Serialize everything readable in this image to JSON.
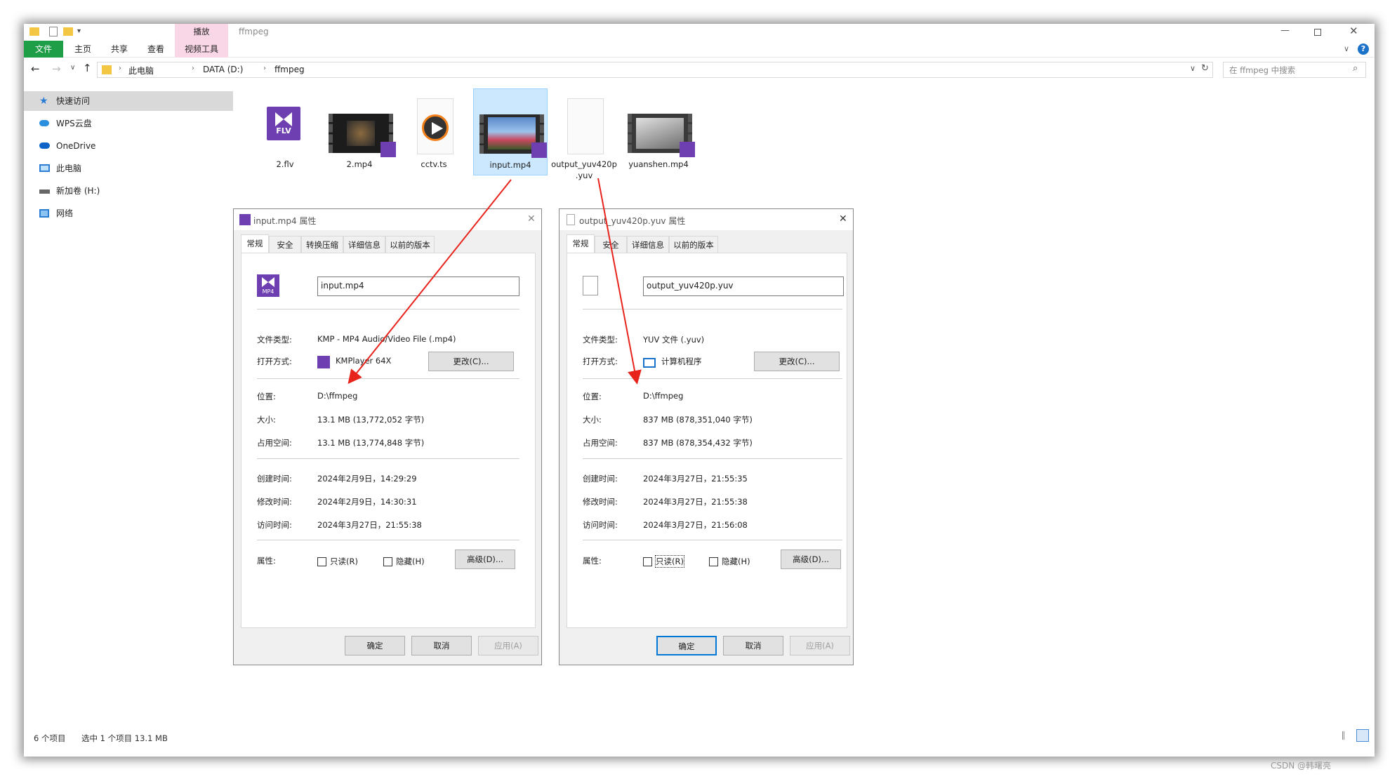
{
  "window": {
    "title": "ffmpeg",
    "context_tab": "播放",
    "ribbon_tabs": [
      "文件",
      "主页",
      "共享",
      "查看",
      "视频工具"
    ],
    "breadcrumb": [
      "此电脑",
      "DATA (D:)",
      "ffmpeg"
    ],
    "search_placeholder": "在 ffmpeg 中搜索",
    "help": "?"
  },
  "nav": {
    "items": [
      "快速访问",
      "WPS云盘",
      "OneDrive",
      "此电脑",
      "新加卷 (H:)",
      "网络"
    ]
  },
  "files": [
    {
      "name": "2.flv",
      "icon_text": "FLV"
    },
    {
      "name": "2.mp4"
    },
    {
      "name": "cctv.ts"
    },
    {
      "name": "input.mp4"
    },
    {
      "name": "output_yuv420p\n.yuv",
      "line1": "output_yuv420p",
      "line2": ".yuv"
    },
    {
      "name": "yuanshen.mp4"
    }
  ],
  "dialog1": {
    "title": "input.mp4 属性",
    "tabs": [
      "常规",
      "安全",
      "转换压缩",
      "详细信息",
      "以前的版本"
    ],
    "icon_text": "MP4",
    "filename": "input.mp4",
    "labels": {
      "type": "文件类型:",
      "open": "打开方式:",
      "loc": "位置:",
      "size": "大小:",
      "disk": "占用空间:",
      "created": "创建时间:",
      "modified": "修改时间:",
      "accessed": "访问时间:",
      "attr": "属性:"
    },
    "type": "KMP - MP4 Audio/Video File (.mp4)",
    "open_with": "KMPlayer 64X",
    "change_btn": "更改(C)...",
    "location": "D:\\ffmpeg",
    "size": "13.1 MB (13,772,052 字节)",
    "disk_size": "13.1 MB (13,774,848 字节)",
    "created": "2024年2月9日，14:29:29",
    "modified": "2024年2月9日，14:30:31",
    "accessed": "2024年3月27日，21:55:38",
    "readonly": "只读(R)",
    "hidden": "隐藏(H)",
    "advanced": "高级(D)...",
    "ok": "确定",
    "cancel": "取消",
    "apply": "应用(A)"
  },
  "dialog2": {
    "title": "output_yuv420p.yuv 属性",
    "tabs": [
      "常规",
      "安全",
      "详细信息",
      "以前的版本"
    ],
    "filename": "output_yuv420p.yuv",
    "labels": {
      "type": "文件类型:",
      "open": "打开方式:",
      "loc": "位置:",
      "size": "大小:",
      "disk": "占用空间:",
      "created": "创建时间:",
      "modified": "修改时间:",
      "accessed": "访问时间:",
      "attr": "属性:"
    },
    "type": "YUV 文件 (.yuv)",
    "open_with": "计算机程序",
    "change_btn": "更改(C)...",
    "location": "D:\\ffmpeg",
    "size": "837 MB (878,351,040 字节)",
    "disk_size": "837 MB (878,354,432 字节)",
    "created": "2024年3月27日，21:55:35",
    "modified": "2024年3月27日，21:55:38",
    "accessed": "2024年3月27日，21:56:08",
    "readonly": "只读(R)",
    "hidden": "隐藏(H)",
    "advanced": "高级(D)...",
    "ok": "确定",
    "cancel": "取消",
    "apply": "应用(A)"
  },
  "status": {
    "count": "6 个项目",
    "selected": "选中 1 个项目  13.1 MB"
  },
  "watermark": "CSDN @韩曙亮",
  "colors": {
    "accent": "#0078d7",
    "file_tab": "#1e9e47",
    "context_tab": "#f9d7e6",
    "arrow": "#e8231b",
    "kmp": "#6e3fb0"
  }
}
